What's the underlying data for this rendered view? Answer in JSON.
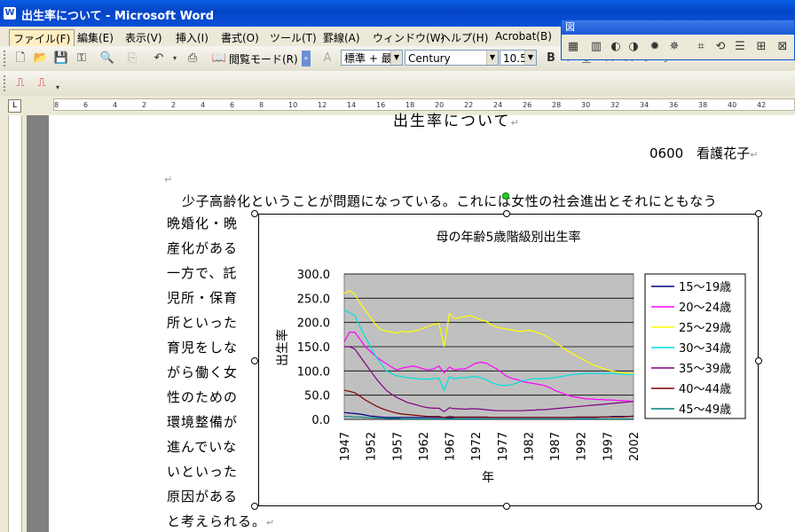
{
  "window": {
    "title": "出生率について - Microsoft Word",
    "app_icon": "word-icon"
  },
  "menu": [
    "ファイル(F)",
    "編集(E)",
    "表示(V)",
    "挿入(I)",
    "書式(O)",
    "ツール(T)",
    "罫線(A)",
    "ウィンドウ(W)",
    "ヘルプ(H)",
    "Acrobat(B)"
  ],
  "toolbar": {
    "read_mode_label": "閲覧モード(R)",
    "style_value": "標準 + 最",
    "font_value": "Century",
    "size_value": "10.5"
  },
  "picture_toolbar": {
    "title": "図"
  },
  "ruler": {
    "numbers": [
      "8",
      "6",
      "4",
      "2",
      "2",
      "4",
      "6",
      "8",
      "10",
      "12",
      "14",
      "16",
      "18",
      "20",
      "22",
      "24",
      "26",
      "28",
      "30",
      "32",
      "34",
      "36",
      "38",
      "40",
      "42"
    ]
  },
  "document": {
    "heading_partial": "出生率について",
    "author": "0600　看護花子",
    "line1": "少子高齢化ということが問題になっている。これには女性の社会進出とそれにともなう",
    "wrap_lines": [
      "晩婚化・晩",
      "産化がある",
      "一方で、託",
      "児所・保育",
      "所といった",
      "育児をしな",
      "がら働く女",
      "性のための",
      "環境整備が",
      "進んでいな",
      "いといった",
      "原因がある",
      "と考えられる。"
    ]
  },
  "chart_data": {
    "type": "line",
    "title": "母の年齢5歳階級別出生率",
    "xlabel": "年",
    "ylabel": "出生率",
    "ylim": [
      0,
      300
    ],
    "yticks": [
      "300.0",
      "250.0",
      "200.0",
      "150.0",
      "100.0",
      "50.0",
      "0.0"
    ],
    "x": [
      1947,
      1948,
      1949,
      1950,
      1951,
      1952,
      1953,
      1954,
      1955,
      1956,
      1957,
      1958,
      1959,
      1960,
      1961,
      1962,
      1963,
      1964,
      1965,
      1966,
      1967,
      1968,
      1969,
      1970,
      1971,
      1972,
      1973,
      1974,
      1975,
      1976,
      1977,
      1978,
      1979,
      1980,
      1981,
      1982,
      1983,
      1984,
      1985,
      1986,
      1987,
      1988,
      1989,
      1990,
      1991,
      1992,
      1993,
      1994,
      1995,
      1996,
      1997,
      1998,
      1999,
      2000,
      2001,
      2002
    ],
    "xtick_labels": [
      "1947",
      "1952",
      "1957",
      "1962",
      "1967",
      "1972",
      "1977",
      "1982",
      "1987",
      "1992",
      "1997",
      "2002"
    ],
    "grid": true,
    "legend_position": "right",
    "series": [
      {
        "name": "15〜19歳",
        "color": "#000080",
        "values": [
          14,
          13,
          12,
          11,
          9,
          7,
          6,
          5,
          4,
          4,
          4,
          4,
          4,
          4,
          4,
          4,
          4,
          4,
          4,
          4,
          3,
          4,
          4,
          4,
          4,
          4,
          4,
          4,
          4,
          4,
          4,
          4,
          4,
          4,
          4,
          4,
          4,
          4,
          4,
          4,
          4,
          4,
          4,
          4,
          4,
          4,
          4,
          4,
          4,
          5,
          5,
          6,
          6,
          6,
          6,
          7
        ]
      },
      {
        "name": "20〜24歳",
        "color": "#ff00ff",
        "values": [
          160,
          180,
          180,
          165,
          150,
          140,
          130,
          122,
          115,
          108,
          102,
          106,
          108,
          110,
          108,
          104,
          102,
          104,
          110,
          96,
          108,
          102,
          104,
          104,
          110,
          116,
          118,
          116,
          110,
          104,
          96,
          88,
          84,
          82,
          78,
          76,
          74,
          72,
          70,
          66,
          60,
          56,
          52,
          48,
          46,
          44,
          42,
          42,
          41,
          41,
          40,
          40,
          39,
          39,
          38,
          37
        ]
      },
      {
        "name": "25〜29歳",
        "color": "#ffff00",
        "values": [
          260,
          265,
          258,
          240,
          225,
          210,
          195,
          185,
          182,
          180,
          178,
          182,
          180,
          182,
          184,
          188,
          192,
          196,
          198,
          150,
          218,
          208,
          210,
          212,
          214,
          210,
          205,
          202,
          195,
          190,
          188,
          186,
          184,
          182,
          182,
          184,
          182,
          178,
          174,
          168,
          160,
          152,
          145,
          138,
          132,
          126,
          120,
          114,
          110,
          106,
          102,
          100,
          97,
          96,
          95,
          94
        ]
      },
      {
        "name": "30〜34歳",
        "color": "#00e0e0",
        "values": [
          225,
          220,
          215,
          190,
          170,
          150,
          130,
          115,
          100,
          95,
          90,
          88,
          86,
          85,
          84,
          83,
          83,
          84,
          85,
          60,
          88,
          84,
          86,
          86,
          88,
          88,
          86,
          82,
          76,
          72,
          70,
          70,
          72,
          76,
          80,
          82,
          84,
          84,
          84,
          85,
          86,
          88,
          90,
          92,
          93,
          94,
          95,
          95,
          95,
          95,
          95,
          95,
          94,
          93,
          93,
          92
        ]
      },
      {
        "name": "35〜39歳",
        "color": "#800080",
        "values": [
          150,
          150,
          145,
          130,
          115,
          100,
          85,
          72,
          60,
          52,
          45,
          40,
          35,
          32,
          29,
          26,
          24,
          23,
          23,
          16,
          24,
          22,
          22,
          21,
          22,
          22,
          21,
          20,
          19,
          18,
          18,
          18,
          18,
          18,
          18,
          19,
          19,
          20,
          20,
          21,
          22,
          23,
          24,
          25,
          26,
          27,
          28,
          29,
          30,
          31,
          32,
          33,
          34,
          35,
          36,
          37
        ]
      },
      {
        "name": "40〜44歳",
        "color": "#800000",
        "values": [
          60,
          58,
          55,
          48,
          40,
          34,
          28,
          23,
          19,
          16,
          13,
          11,
          10,
          9,
          8,
          7,
          6,
          6,
          6,
          4,
          6,
          5,
          5,
          5,
          5,
          5,
          5,
          5,
          4,
          4,
          4,
          4,
          4,
          4,
          4,
          4,
          4,
          4,
          4,
          4,
          4,
          4,
          4,
          4,
          5,
          5,
          5,
          5,
          5,
          5,
          5,
          5,
          5,
          5,
          6,
          6
        ]
      },
      {
        "name": "45〜49歳",
        "color": "#008080",
        "values": [
          6,
          6,
          5,
          5,
          4,
          4,
          3,
          3,
          2,
          2,
          2,
          1,
          1,
          1,
          1,
          1,
          1,
          1,
          1,
          1,
          1,
          1,
          1,
          1,
          1,
          1,
          1,
          1,
          1,
          1,
          1,
          1,
          1,
          1,
          1,
          1,
          1,
          1,
          1,
          1,
          1,
          1,
          1,
          1,
          1,
          1,
          1,
          1,
          1,
          1,
          1,
          1,
          1,
          1,
          1,
          1
        ]
      }
    ]
  }
}
